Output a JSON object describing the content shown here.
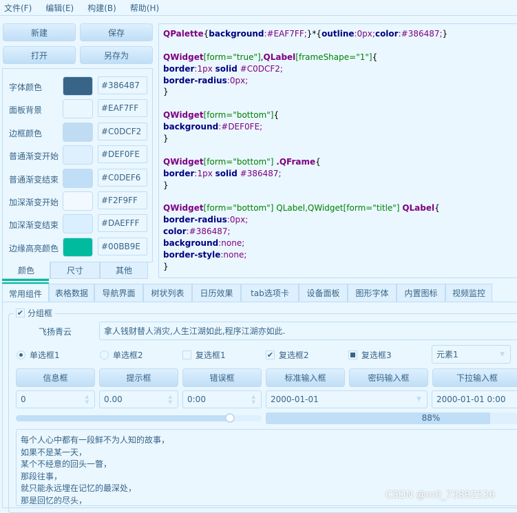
{
  "menu": [
    "文件(F)",
    "编辑(E)",
    "构建(B)",
    "帮助(H)"
  ],
  "buttons": {
    "new": "新建",
    "save": "保存",
    "open": "打开",
    "save_as": "另存为"
  },
  "colors": [
    {
      "label": "字体颜色",
      "hex": "#386487"
    },
    {
      "label": "面板背景",
      "hex": "#EAF7FF"
    },
    {
      "label": "边框颜色",
      "hex": "#C0DCF2"
    },
    {
      "label": "普通渐变开始",
      "hex": "#DEF0FE"
    },
    {
      "label": "普通渐变结束",
      "hex": "#C0DEF6"
    },
    {
      "label": "加深渐变开始",
      "hex": "#F2F9FF"
    },
    {
      "label": "加深渐变结束",
      "hex": "#DAEFFF"
    },
    {
      "label": "边缘高亮颜色",
      "hex": "#00BB9E"
    }
  ],
  "side_tabs": [
    "颜色",
    "尺寸",
    "其他"
  ],
  "code": [
    [
      [
        "sel",
        "QPalette"
      ],
      [
        "pun",
        "{"
      ],
      [
        "prop",
        "background"
      ],
      [
        "val",
        ":#EAF7FF;"
      ],
      [
        "pun",
        "}*{"
      ],
      [
        "prop",
        "outline"
      ],
      [
        "val",
        ":0px;"
      ],
      [
        "prop",
        "color"
      ],
      [
        "val",
        ":#386487;"
      ],
      [
        "pun",
        "}"
      ]
    ],
    [],
    [
      [
        "sel",
        "QWidget"
      ],
      [
        "attr",
        "[form=\"true\"]"
      ],
      [
        "pun",
        ","
      ],
      [
        "sel",
        "QLabel"
      ],
      [
        "attr",
        "[frameShape=\"1\"]"
      ],
      [
        "pun",
        "{"
      ]
    ],
    [
      [
        "prop",
        "border"
      ],
      [
        "val",
        ":1px "
      ],
      [
        "prop",
        "solid"
      ],
      [
        "val",
        " #C0DCF2;"
      ]
    ],
    [
      [
        "prop",
        "border-radius"
      ],
      [
        "val",
        ":0px;"
      ]
    ],
    [
      [
        "pun",
        "}"
      ]
    ],
    [],
    [
      [
        "sel",
        "QWidget"
      ],
      [
        "attr",
        "[form=\"bottom\"]"
      ],
      [
        "pun",
        "{"
      ]
    ],
    [
      [
        "prop",
        "background"
      ],
      [
        "val",
        ":#DEF0FE;"
      ]
    ],
    [
      [
        "pun",
        "}"
      ]
    ],
    [],
    [
      [
        "sel",
        "QWidget"
      ],
      [
        "attr",
        "[form=\"bottom\"] "
      ],
      [
        "sel",
        ".QFrame"
      ],
      [
        "pun",
        "{"
      ]
    ],
    [
      [
        "prop",
        "border"
      ],
      [
        "val",
        ":1px "
      ],
      [
        "prop",
        "solid"
      ],
      [
        "val",
        " #386487;"
      ]
    ],
    [
      [
        "pun",
        "}"
      ]
    ],
    [],
    [
      [
        "sel",
        "QWidget"
      ],
      [
        "attr",
        "[form=\"bottom\"] QLabel,QWidget[form=\"title\"] "
      ],
      [
        "sel",
        "QLabel"
      ],
      [
        "pun",
        "{"
      ]
    ],
    [
      [
        "prop",
        "border-radius"
      ],
      [
        "val",
        ":0px;"
      ]
    ],
    [
      [
        "prop",
        "color"
      ],
      [
        "val",
        ":#386487;"
      ]
    ],
    [
      [
        "prop",
        "background"
      ],
      [
        "val",
        ":none;"
      ]
    ],
    [
      [
        "prop",
        "border-style"
      ],
      [
        "val",
        ":none;"
      ]
    ],
    [
      [
        "pun",
        "}"
      ]
    ]
  ],
  "main_tabs": [
    "常用组件",
    "表格数据",
    "导航界面",
    "树状列表",
    "日历效果",
    "tab选项卡",
    "设备面板",
    "图形字体",
    "内置图标",
    "视频监控"
  ],
  "group": {
    "title": "分组框",
    "label": "飞扬青云",
    "line_edit": "拿人钱财替人消灾,人生江湖如此,程序江湖亦如此."
  },
  "radios": [
    {
      "label": "单选框1",
      "checked": true
    },
    {
      "label": "单选框2",
      "checked": false
    }
  ],
  "checks": [
    {
      "label": "复选框1",
      "state": "unchecked"
    },
    {
      "label": "复选框2",
      "state": "checked"
    },
    {
      "label": "复选框3",
      "state": "partial"
    }
  ],
  "combo": "元素1",
  "action_buttons": [
    "信息框",
    "提示框",
    "错误框",
    "标准输入框",
    "密码输入框",
    "下拉输入框"
  ],
  "spin": {
    "int": "0",
    "double": "0.00",
    "time": "0:00",
    "date": "2000-01-01",
    "datetime": "2000-01-01 0:00"
  },
  "slider_value": 0.87,
  "progress": {
    "value": 88,
    "label": "88%"
  },
  "text_lines": [
    "每个人心中都有一段鲜不为人知的故事，",
    "如果不是某一天，",
    "某个不经意的回头一瞥，",
    "那段往事，",
    "就只能永远埋在记忆的最深处，",
    "那是回忆的尽头，"
  ],
  "watermark": "CSDN @m0_73892536"
}
